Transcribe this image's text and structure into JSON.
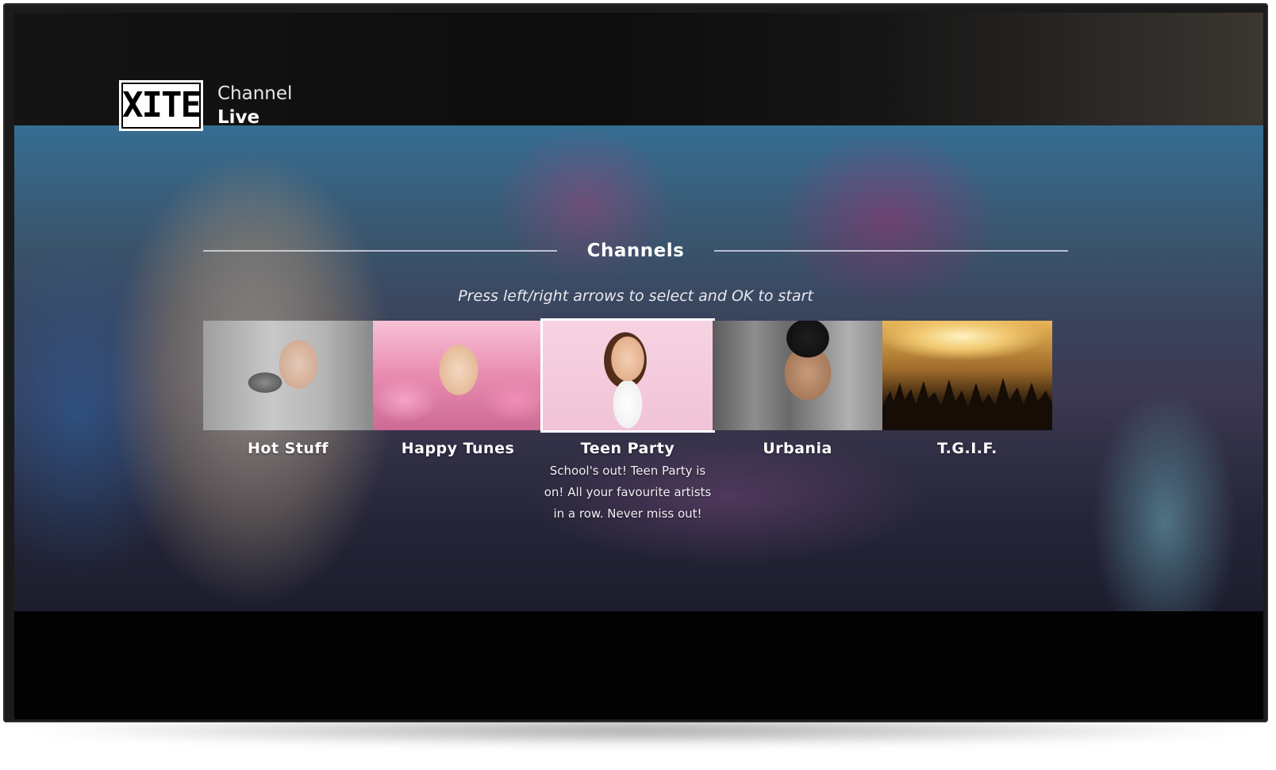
{
  "app": {
    "logo_text": "XITE",
    "line1": "Channel",
    "line2": "Live"
  },
  "section": {
    "title": "Channels",
    "hint": "Press left/right arrows to select and OK to start"
  },
  "channels": [
    {
      "label": "Hot Stuff",
      "description": ""
    },
    {
      "label": "Happy Tunes",
      "description": ""
    },
    {
      "label": "Teen Party",
      "description": "School's out! Teen Party is on! All your favourite artists in a row. Never miss out!"
    },
    {
      "label": "Urbania",
      "description": ""
    },
    {
      "label": "T.G.I.F.",
      "description": ""
    }
  ],
  "selected_channel": "Teen Party",
  "colors": {
    "selection_border": "#ffffff",
    "text": "#ffffff",
    "background": "#050505"
  }
}
